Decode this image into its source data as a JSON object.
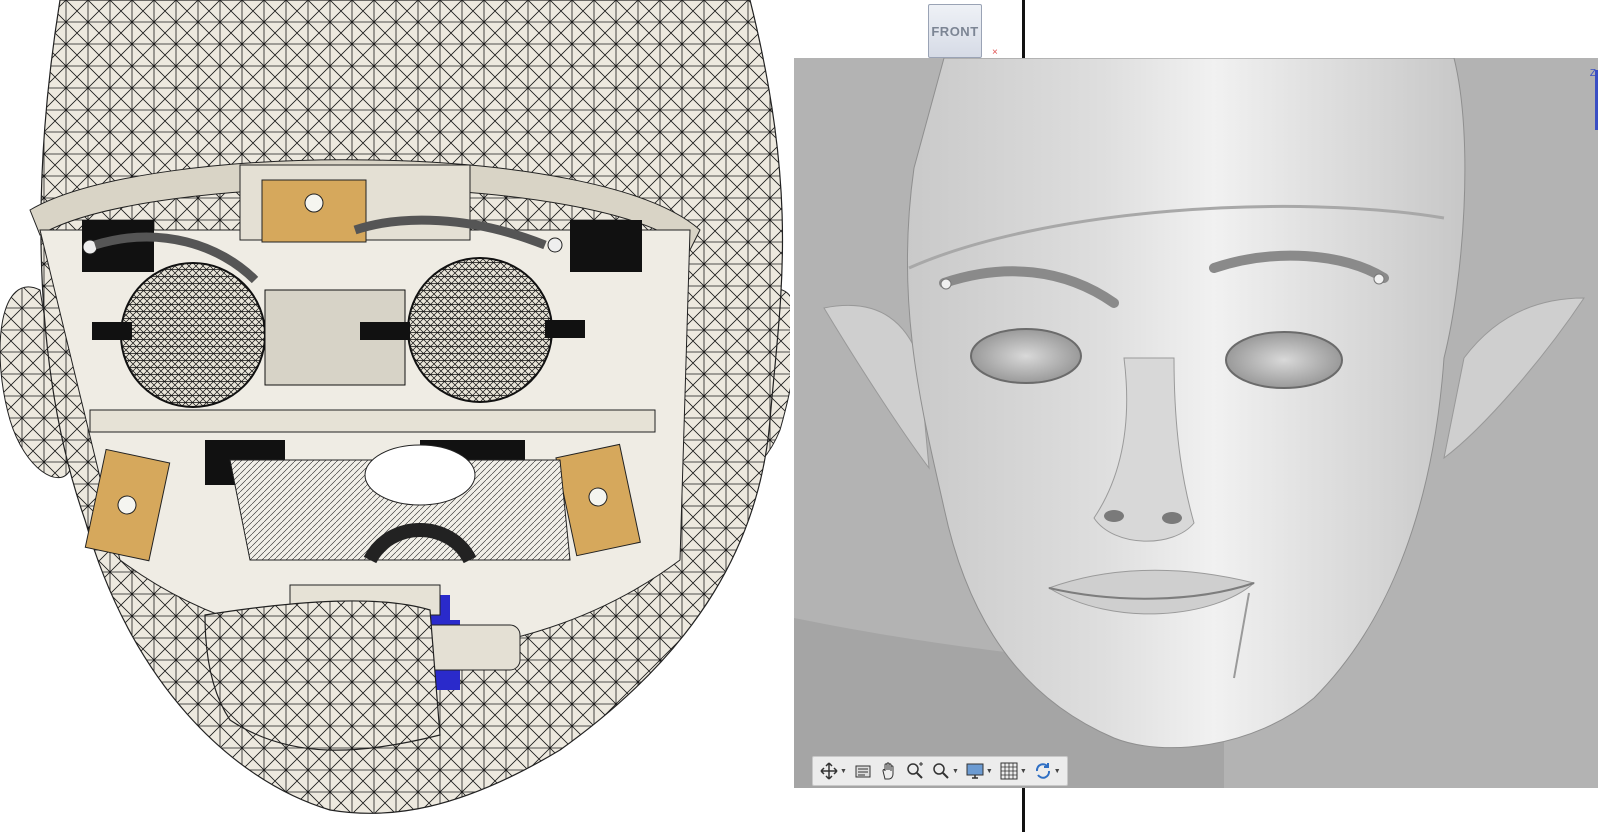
{
  "viewcube": {
    "face_label": "FRONT"
  },
  "viewport": {
    "axis_label": "Z",
    "toolbar": [
      {
        "icon": "pan-orbit-icon",
        "has_menu": true
      },
      {
        "icon": "view-capture-icon",
        "has_menu": false
      },
      {
        "icon": "pan-hand-icon",
        "has_menu": false
      },
      {
        "icon": "zoom-icon",
        "has_menu": false
      },
      {
        "icon": "zoom-window-icon",
        "has_menu": true
      },
      {
        "icon": "display-settings-icon",
        "has_menu": true
      },
      {
        "icon": "grid-icon",
        "has_menu": true
      },
      {
        "icon": "rotate-view-icon",
        "has_menu": true
      }
    ]
  },
  "colors": {
    "mesh_fill": "#ede9df",
    "mesh_line": "#1b1b1b",
    "bracket": "#d6a85c",
    "servo_blue": "#2a2acb",
    "viewport_bg": "#b3b3b3",
    "face_shade": "#dcdcdc"
  }
}
